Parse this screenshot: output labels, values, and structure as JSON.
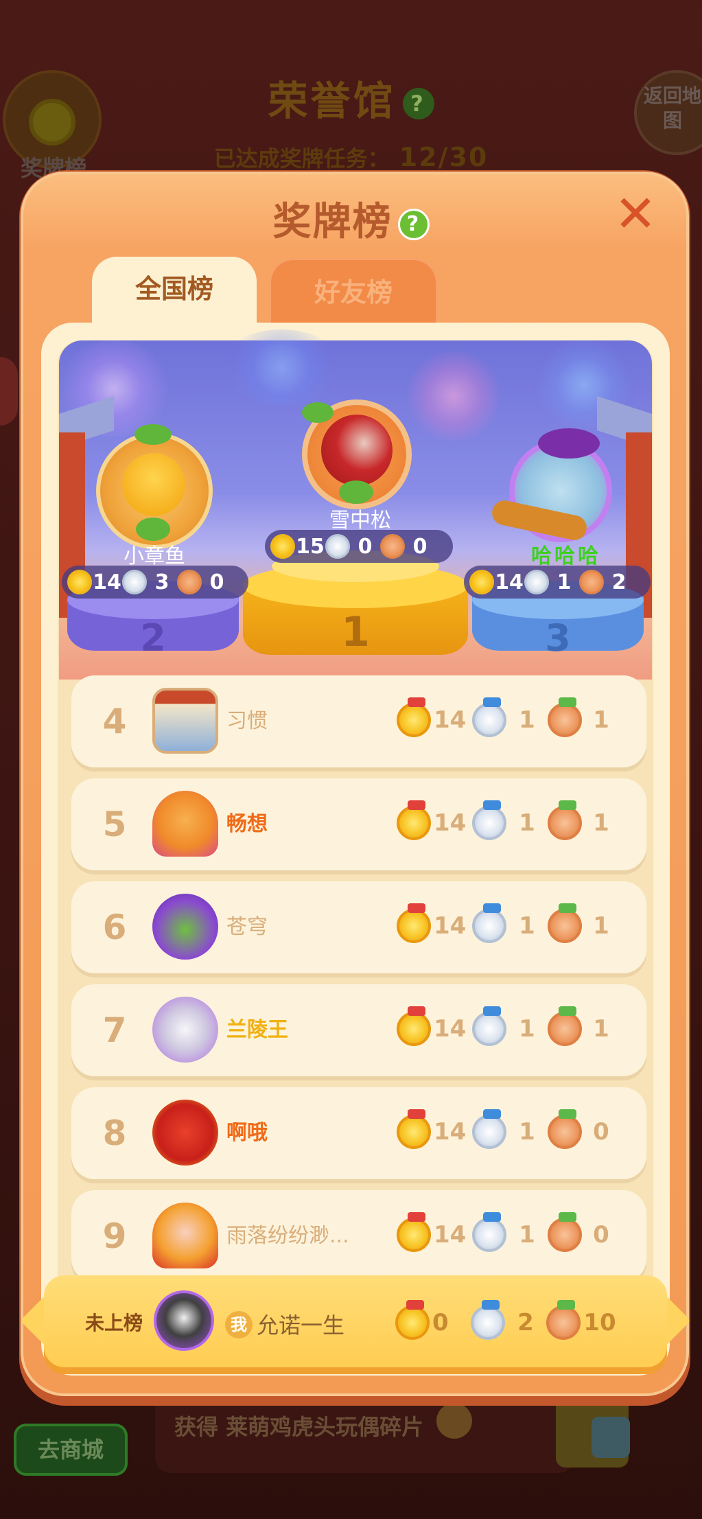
{
  "background": {
    "title": "荣誉馆",
    "help_icon": "?",
    "progress_label": "已达成奖牌任务：",
    "progress_value": "12/30",
    "medal_button_label": "奖牌榜",
    "return_label": "返回地图",
    "shop_button_label": "去商城",
    "reward_text": "获得 莱萌鸡虎头玩偶碎片"
  },
  "modal": {
    "title": "奖牌榜",
    "help_icon": "?",
    "close_icon": "✕",
    "tabs": [
      {
        "label": "全国榜",
        "active": true
      },
      {
        "label": "好友榜",
        "active": false
      }
    ]
  },
  "podium": [
    {
      "rank": "1",
      "name": "雪中松",
      "gold": "15",
      "silver": "0",
      "bronze": "0"
    },
    {
      "rank": "2",
      "name": "小章鱼",
      "gold": "14",
      "silver": "3",
      "bronze": "0"
    },
    {
      "rank": "3",
      "name": "哈哈哈",
      "gold": "14",
      "silver": "1",
      "bronze": "2"
    }
  ],
  "rankings": [
    {
      "rank": "4",
      "name": "习惯",
      "name_color": "#d9ad79",
      "bold": false,
      "gold": "14",
      "silver": "1",
      "bronze": "1"
    },
    {
      "rank": "5",
      "name": "畅想",
      "name_color": "#f06a18",
      "bold": true,
      "gold": "14",
      "silver": "1",
      "bronze": "1"
    },
    {
      "rank": "6",
      "name": "苍穹",
      "name_color": "#d9ad79",
      "bold": false,
      "gold": "14",
      "silver": "1",
      "bronze": "1"
    },
    {
      "rank": "7",
      "name": "兰陵王",
      "name_color": "#f0b010",
      "bold": true,
      "gold": "14",
      "silver": "1",
      "bronze": "1"
    },
    {
      "rank": "8",
      "name": "啊哦",
      "name_color": "#f06a18",
      "bold": true,
      "gold": "14",
      "silver": "1",
      "bronze": "0"
    },
    {
      "rank": "9",
      "name": "雨落纷纷渺...",
      "name_color": "#d9ad79",
      "bold": false,
      "gold": "14",
      "silver": "1",
      "bronze": "0"
    }
  ],
  "me": {
    "status": "未上榜",
    "tag": "我",
    "name": "允诺一生",
    "gold": "0",
    "silver": "2",
    "bronze": "10"
  }
}
